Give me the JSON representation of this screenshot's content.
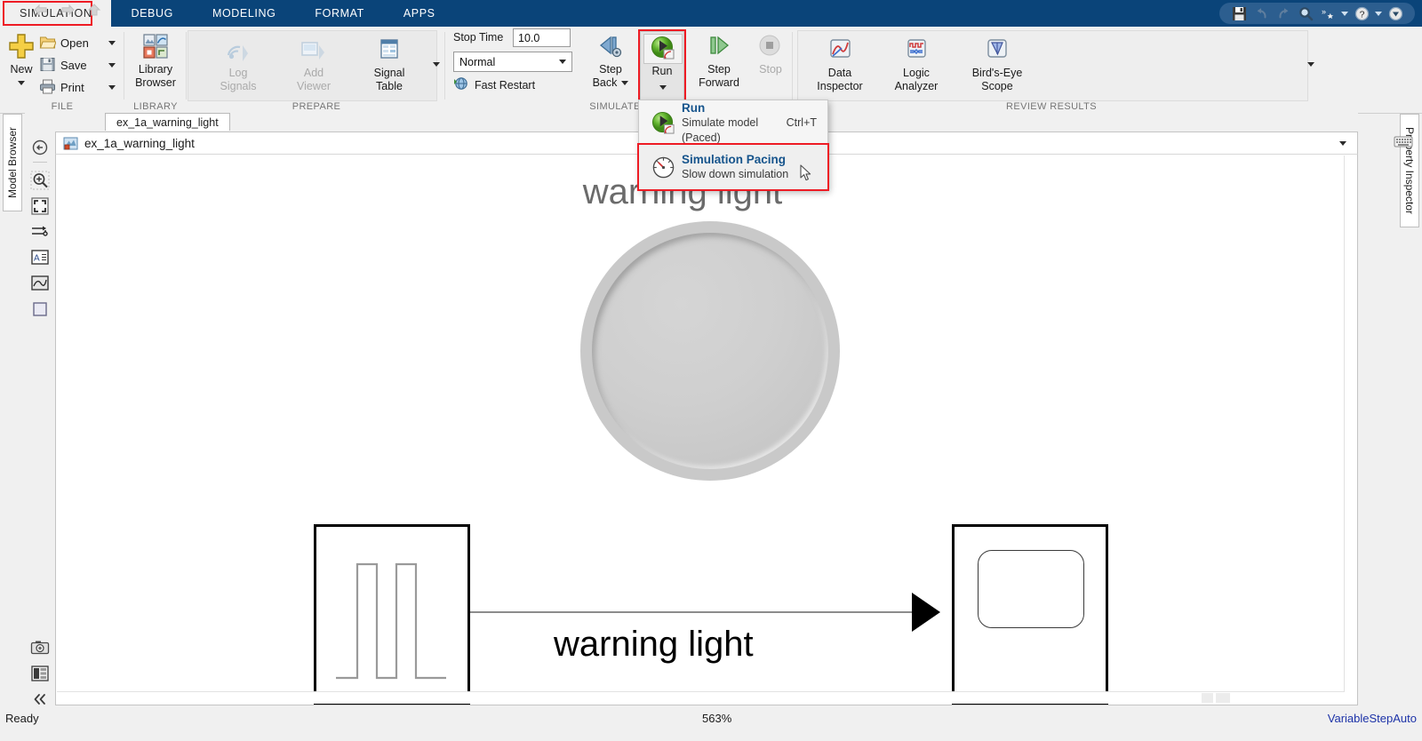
{
  "app": {
    "tabs": [
      {
        "label": "SIMULATION",
        "active": true
      },
      {
        "label": "DEBUG",
        "active": false
      },
      {
        "label": "MODELING",
        "active": false
      },
      {
        "label": "FORMAT",
        "active": false
      },
      {
        "label": "APPS",
        "active": false
      }
    ],
    "quick_access": [
      "save-icon",
      "undo-icon",
      "redo-icon",
      "search-icon",
      "shortcuts-icon",
      "chevron-down-icon",
      "help-icon",
      "chevron-down-icon",
      "dropdown-circle-icon"
    ],
    "accent_blue": "#0a4479",
    "highlight_red": "#ee1b24",
    "link_blue": "#16548c"
  },
  "ribbon": {
    "groups": [
      {
        "name": "FILE",
        "label": "FILE"
      },
      {
        "name": "LIBRARY",
        "label": "LIBRARY"
      },
      {
        "name": "PREPARE",
        "label": "PREPARE"
      },
      {
        "name": "SIMULATE",
        "label": "SIMULATE"
      },
      {
        "name": "REVIEW RESULTS",
        "label": "REVIEW RESULTS"
      }
    ],
    "file": {
      "new_label": "New",
      "open_label": "Open",
      "save_label": "Save",
      "print_label": "Print"
    },
    "library": {
      "line1": "Library",
      "line2": "Browser"
    },
    "prepare": {
      "log_signals_line1": "Log",
      "log_signals_line2": "Signals",
      "add_viewer_line1": "Add",
      "add_viewer_line2": "Viewer",
      "signal_table_line1": "Signal",
      "signal_table_line2": "Table"
    },
    "simulate": {
      "stop_time_label": "Stop Time",
      "stop_time_value": "10.0",
      "mode_value": "Normal",
      "fast_restart_label": "Fast Restart",
      "step_back_line1": "Step",
      "step_back_line2": "Back",
      "run_label": "Run",
      "step_forward_line1": "Step",
      "step_forward_line2": "Forward",
      "stop_label": "Stop"
    },
    "review": {
      "data_inspector_line1": "Data",
      "data_inspector_line2": "Inspector",
      "logic_analyzer_line1": "Logic",
      "logic_analyzer_line2": "Analyzer",
      "birdseye_line1": "Bird's-Eye",
      "birdseye_line2": "Scope"
    }
  },
  "run_menu": {
    "items": [
      {
        "title": "Run",
        "subtitle": "Simulate model (Paced)",
        "shortcut": "Ctrl+T",
        "icon": "run-green-icon",
        "highlighted": false
      },
      {
        "title": "Simulation Pacing",
        "subtitle": "Slow down simulation",
        "shortcut": "",
        "icon": "pacing-gauge-icon",
        "highlighted": true
      }
    ]
  },
  "editor": {
    "model_tab_label": "ex_1a_warning_light",
    "breadcrumb_label": "ex_1a_warning_light",
    "left_panel_tab": "Model Browser",
    "right_panel_tab": "Property Inspector",
    "nav_icons": [
      "back-arrow-icon",
      "forward-arrow-icon",
      "up-arrow-icon"
    ],
    "left_tools": [
      "zoom-fit-to-view-icon",
      "zoom-in-region-icon",
      "fit-to-screen-icon",
      "signal-routing-icon",
      "annotation-icon",
      "viewer-icon",
      "subsystem-icon"
    ],
    "left_tools_bottom": [
      "camera-icon",
      "layout-icon",
      "collapse-icon"
    ]
  },
  "canvas": {
    "lamp_title": "warning light",
    "signal_label": "warning light",
    "source_block": "pulse-generator-block",
    "sink_block": "display-lamp-block"
  },
  "status": {
    "ready": "Ready",
    "zoom": "563%",
    "solver": "VariableStepAuto"
  }
}
